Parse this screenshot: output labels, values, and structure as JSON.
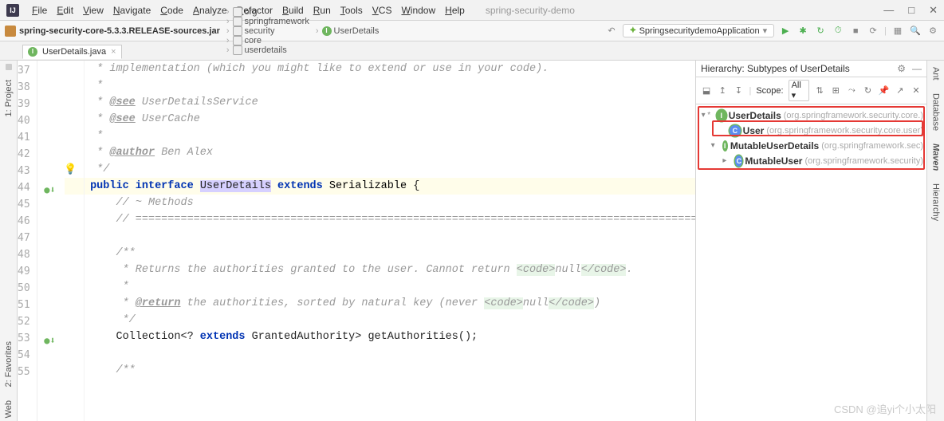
{
  "title": {
    "project": "spring-security-demo"
  },
  "menu": [
    "File",
    "Edit",
    "View",
    "Navigate",
    "Code",
    "Analyze",
    "Refactor",
    "Build",
    "Run",
    "Tools",
    "VCS",
    "Window",
    "Help"
  ],
  "breadcrumb": {
    "jar": "spring-security-core-5.3.3.RELEASE-sources.jar",
    "parts": [
      "org",
      "springframework",
      "security",
      "core",
      "userdetails"
    ],
    "cls": "UserDetails"
  },
  "runconfig": "SpringsecuritydemoApplication",
  "tab": {
    "name": "UserDetails.java"
  },
  "hierarchy": {
    "title": "Hierarchy: Subtypes of UserDetails",
    "scope_label": "Scope:",
    "scope_value": "All",
    "tree": [
      {
        "lvl": 0,
        "exp": "v",
        "star": "*",
        "icon": "i",
        "ring": true,
        "name": "UserDetails",
        "pkg": "(org.springframework.security.core.)"
      },
      {
        "lvl": 1,
        "exp": "",
        "star": "",
        "icon": "c",
        "ring": true,
        "name": "User",
        "pkg": "(org.springframework.security.core.user)"
      },
      {
        "lvl": 1,
        "exp": "v",
        "star": "",
        "icon": "i",
        "ring": false,
        "name": "MutableUserDetails",
        "pkg": "(org.springframework.sec)"
      },
      {
        "lvl": 2,
        "exp": ">",
        "star": "",
        "icon": "c",
        "ring": true,
        "name": "MutableUser",
        "pkg": "(org.springframework.security)"
      }
    ]
  },
  "code": {
    "lines": [
      {
        "n": 37,
        "t": "     * implementation (which you might like to extend or use in your code).",
        "cls": "jd"
      },
      {
        "n": 38,
        "t": "     *",
        "cls": "jd"
      },
      {
        "n": 39,
        "html": "     * <span class='jtag'>@see</span> UserDetailsService",
        "cls": "jd"
      },
      {
        "n": 40,
        "html": "     * <span class='jtag'>@see</span> UserCache",
        "cls": "jd"
      },
      {
        "n": 41,
        "t": "     *",
        "cls": "jd"
      },
      {
        "n": 42,
        "html": "     * <span class='jtag'>@author</span> Ben Alex",
        "cls": "jd"
      },
      {
        "n": 43,
        "t": "     */",
        "cls": "jd",
        "bulb": true
      },
      {
        "n": 44,
        "html": "    <span class='kw'>public</span> <span class='kw'>interface</span> <span class='hl'>UserDetails</span> <span class='kw'>extends</span> <span class='cls'>Serializable</span> {",
        "hlrow": true,
        "mark": "⬇"
      },
      {
        "n": 45,
        "t": "        // ~ Methods",
        "cls": "cm"
      },
      {
        "n": 46,
        "t": "        // ========================================================================================================",
        "cls": "cm"
      },
      {
        "n": 47,
        "t": ""
      },
      {
        "n": 48,
        "t": "        /**",
        "cls": "jd"
      },
      {
        "n": 49,
        "html": "         * Returns the authorities granted to the user. Cannot return <span class='xtag'>&lt;code&gt;</span>null<span class='xtag'>&lt;/code&gt;</span>.",
        "cls": "jd"
      },
      {
        "n": 50,
        "t": "         *",
        "cls": "jd"
      },
      {
        "n": 51,
        "html": "         * <span class='jtag'>@return</span> the authorities, sorted by natural key (never <span class='xtag'>&lt;code&gt;</span>null<span class='xtag'>&lt;/code&gt;</span>)",
        "cls": "jd"
      },
      {
        "n": 52,
        "t": "         */",
        "cls": "jd"
      },
      {
        "n": 53,
        "html": "        Collection&lt;? <span class='kw'>extends</span> GrantedAuthority&gt; getAuthorities();",
        "mark": "⬇"
      },
      {
        "n": 54,
        "t": ""
      },
      {
        "n": 55,
        "t": "        /**",
        "cls": "jd"
      }
    ]
  },
  "left": [
    "1: Project",
    "2: Favorites",
    "Web"
  ],
  "right": [
    "Ant",
    "Database",
    "Maven",
    "Hierarchy"
  ],
  "watermark": "CSDN @追yi个小太阳"
}
